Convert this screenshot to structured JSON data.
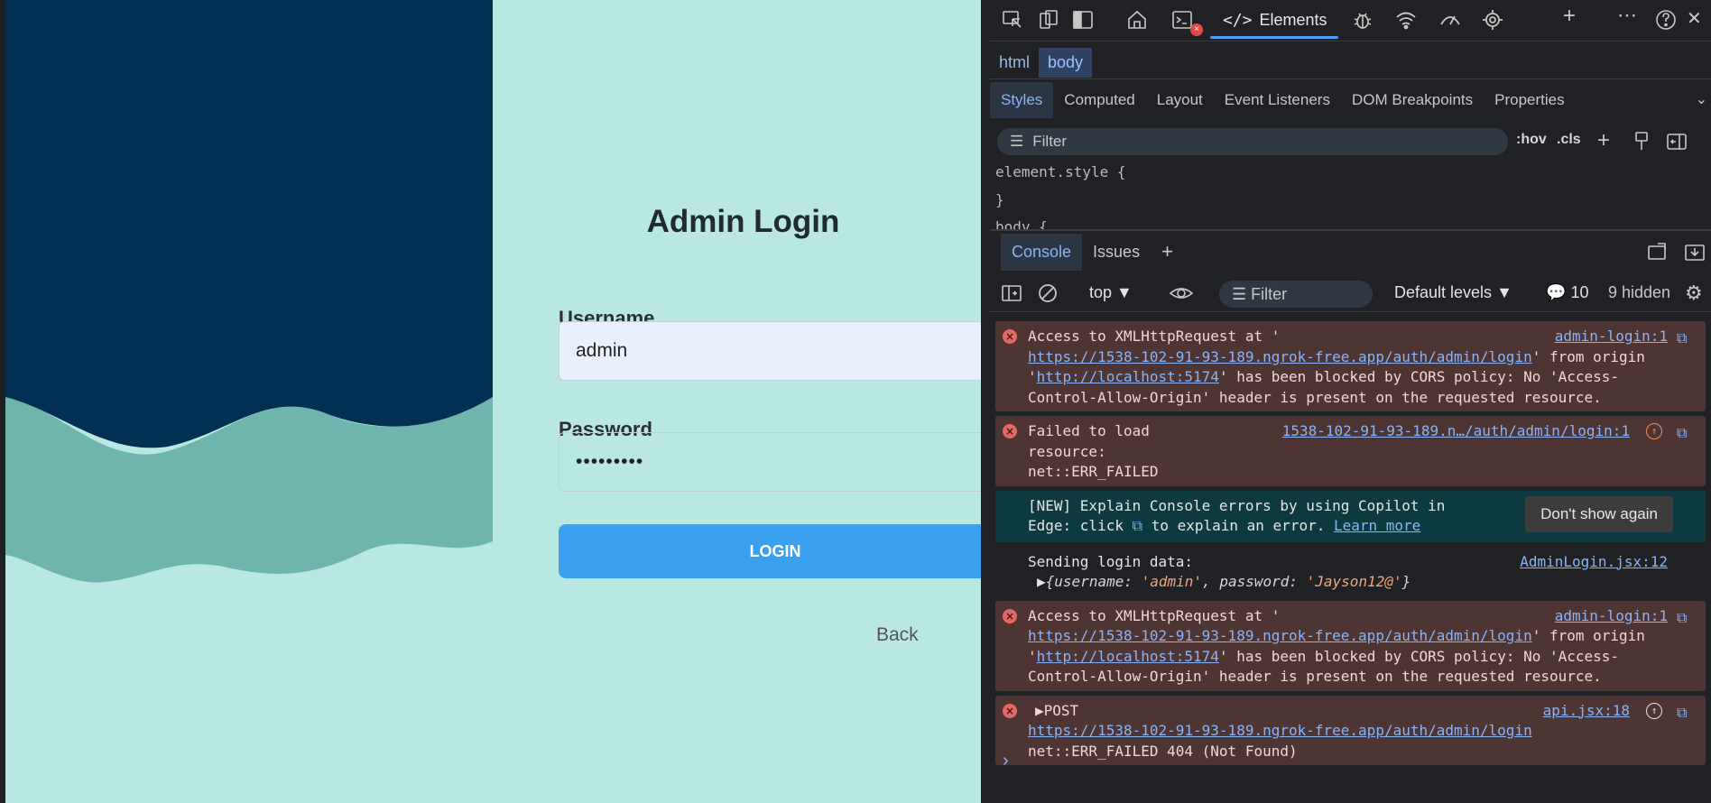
{
  "app": {
    "title": "Admin Login",
    "username_label": "Username",
    "username_value": "admin",
    "password_label": "Password",
    "password_value": "•••••••••",
    "login_button": "LOGIN",
    "back_link": "Back",
    "colors": {
      "background": "#b9e7e1",
      "wave_dark": "#022f52",
      "wave_mid": "#6fb5ad",
      "button": "#3aa0f0"
    }
  },
  "devtools": {
    "main_tab": "Elements",
    "breadcrumb": [
      "html",
      "body"
    ],
    "styles_tabs": [
      "Styles",
      "Computed",
      "Layout",
      "Event Listeners",
      "DOM Breakpoints",
      "Properties"
    ],
    "filter_placeholder": "Filter",
    "hov": ":hov",
    "cls": ".cls",
    "style_line1": "element.style {",
    "style_line2": "}",
    "style_line3": "body {",
    "console_tabs": [
      "Console",
      "Issues"
    ],
    "context": "top",
    "console_filter": "Filter",
    "levels": "Default levels",
    "message_count": "10",
    "hidden": "9 hidden",
    "messages": {
      "m1": {
        "line1": "Access to XMLHttpRequest at '",
        "url": "https://1538-102-91-93-189.ngrok-free.app/auth/admin/login",
        "after_url": "' from origin",
        "origin_pre": "'",
        "origin": "http://localhost:5174",
        "origin_post": "' has been blocked by CORS policy: No 'Access-",
        "line4": "Control-Allow-Origin' header is present on the requested resource.",
        "source": "admin-login:1"
      },
      "m2": {
        "line1": "Failed to load",
        "line2": "resource:",
        "line3": "net::ERR_FAILED",
        "source": "1538-102-91-93-189.n…/auth/admin/login:1"
      },
      "m3": {
        "line1": "[NEW] Explain Console errors by using Copilot in",
        "line2a": "Edge: click",
        "line2b": "to explain an error.",
        "learn_more": "Learn more",
        "button": "Don't show again"
      },
      "m4": {
        "line1": "Sending login data:",
        "key1": "username",
        "val1": "'admin'",
        "key2": "password",
        "val2": "'Jayson12@'",
        "source": "AdminLogin.jsx:12"
      },
      "m5": {
        "line1": "Access to XMLHttpRequest at '",
        "url": "https://1538-102-91-93-189.ngrok-free.app/auth/admin/login",
        "after_url": "' from origin",
        "origin_pre": "'",
        "origin": "http://localhost:5174",
        "origin_post": "' has been blocked by CORS policy: No 'Access-",
        "line4": "Control-Allow-Origin' header is present on the requested resource.",
        "source": "admin-login:1"
      },
      "m6": {
        "method": "POST",
        "url": "https://1538-102-91-93-189.ngrok-free.app/auth/admin/login",
        "line3": "net::ERR_FAILED 404 (Not Found)",
        "source": "api.jsx:18"
      }
    }
  }
}
